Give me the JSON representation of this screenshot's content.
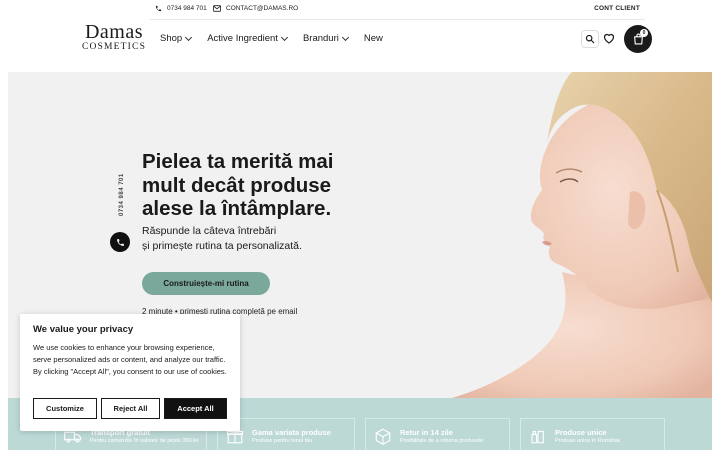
{
  "topbar": {
    "phone": "0734 984 701",
    "email": "CONTACT@DAMAS.RO",
    "account": "CONT CLIENT"
  },
  "logo": {
    "line1": "Damas",
    "line2": "COSMETICS"
  },
  "nav": [
    {
      "label": "Shop",
      "has_dropdown": true
    },
    {
      "label": "Active Ingredient",
      "has_dropdown": true
    },
    {
      "label": "Branduri",
      "has_dropdown": true
    },
    {
      "label": "New",
      "has_dropdown": false
    }
  ],
  "header_icons": {
    "search": "search-icon",
    "wishlist": "heart-icon",
    "cart": "cart-icon"
  },
  "cart": {
    "count": "0"
  },
  "hero": {
    "vertical_phone": "0734 984 701",
    "title_lines": [
      "Pielea ta merită mai",
      "mult decât produse",
      "alese la întâmplare."
    ],
    "subtitle_lines": [
      "Răspunde la câteva întrebări",
      "și primește rutina ta personalizată."
    ],
    "cta_label": "Construiește-mi rutina",
    "note": "2 minute • primești rutina completă pe email"
  },
  "features": [
    {
      "title": "Transport gratuit",
      "desc": "Pentru comenzile în valoare de peste 350 lei",
      "icon": "truck-icon"
    },
    {
      "title": "Gama variata produse",
      "desc": "Produse pentru tenul tău",
      "icon": "gift-icon"
    },
    {
      "title": "Retur in 14 zile",
      "desc": "Posibilitate de a returna produsele",
      "icon": "return-box-icon"
    },
    {
      "title": "Produse unice",
      "desc": "Produse unice în România",
      "icon": "products-icon"
    }
  ],
  "cookie": {
    "title": "We value your privacy",
    "text": "We use cookies to enhance your browsing experience, serve personalized ads or content, and analyze our traffic. By clicking \"Accept All\", you consent to our use of cookies.",
    "customize_label": "Customize",
    "reject_label": "Reject All",
    "accept_label": "Accept All"
  },
  "colors": {
    "accent": "#7aa89b",
    "band": "#bdd9d6",
    "hero_bg": "#f1f1f1",
    "dark": "#1a1a1a"
  }
}
